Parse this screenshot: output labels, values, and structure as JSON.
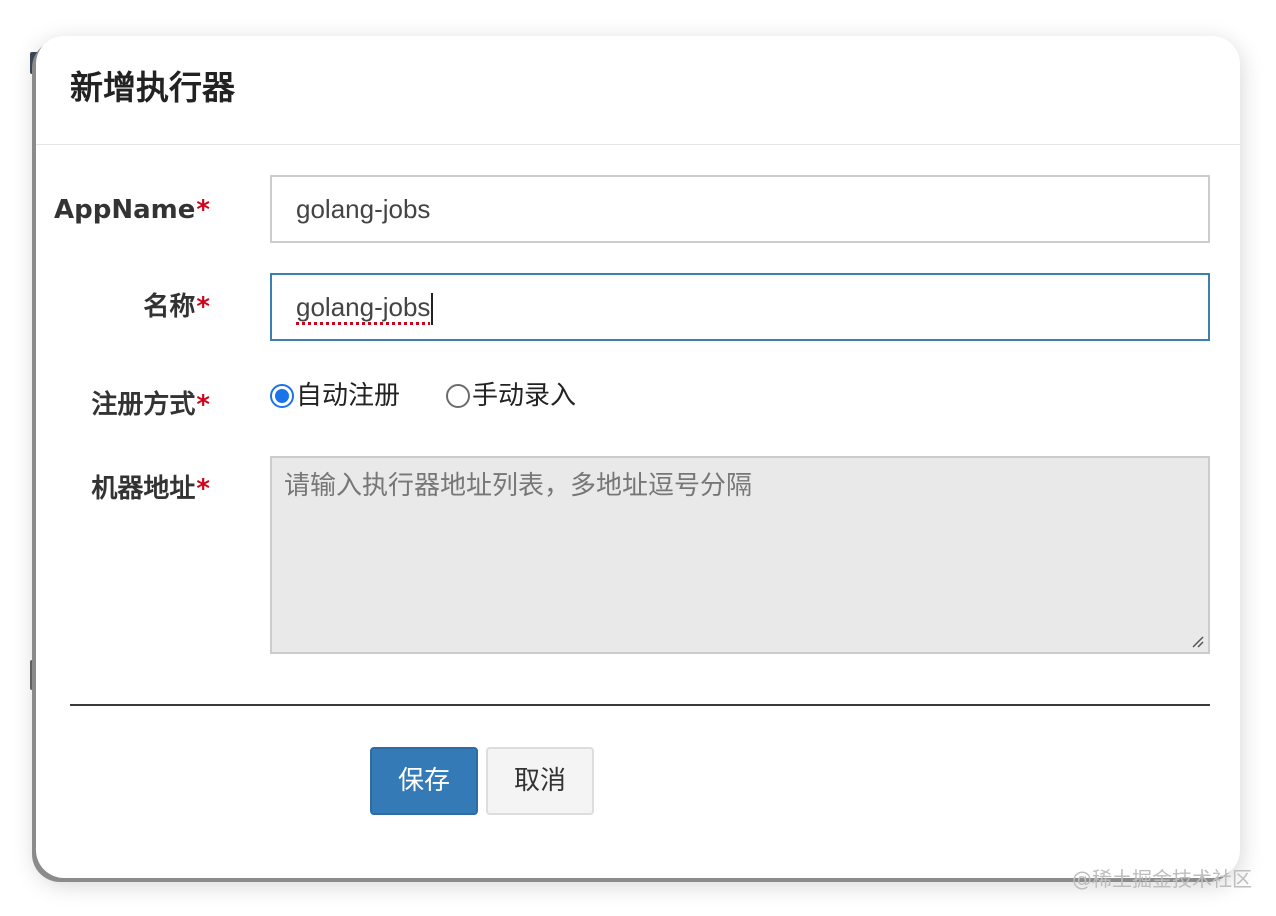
{
  "modal": {
    "title": "新增执行器"
  },
  "form": {
    "appname": {
      "label": "AppName",
      "required_mark": "*",
      "value": "golang-jobs"
    },
    "name": {
      "label": "名称",
      "required_mark": "*",
      "value": "golang-jobs"
    },
    "register_type": {
      "label": "注册方式",
      "required_mark": "*",
      "options": [
        {
          "label": "自动注册",
          "checked": true
        },
        {
          "label": "手动录入",
          "checked": false
        }
      ]
    },
    "address": {
      "label": "机器地址",
      "required_mark": "*",
      "placeholder": "请输入执行器地址列表，多地址逗号分隔"
    }
  },
  "buttons": {
    "save": "保存",
    "cancel": "取消"
  },
  "watermark": "@稀土掘金技术社区",
  "colors": {
    "primary": "#337ab7",
    "required": "#d0021b",
    "focus_border": "#3c7fb1",
    "radio_checked": "#1a73e8",
    "textarea_bg": "#e9e9e9"
  }
}
